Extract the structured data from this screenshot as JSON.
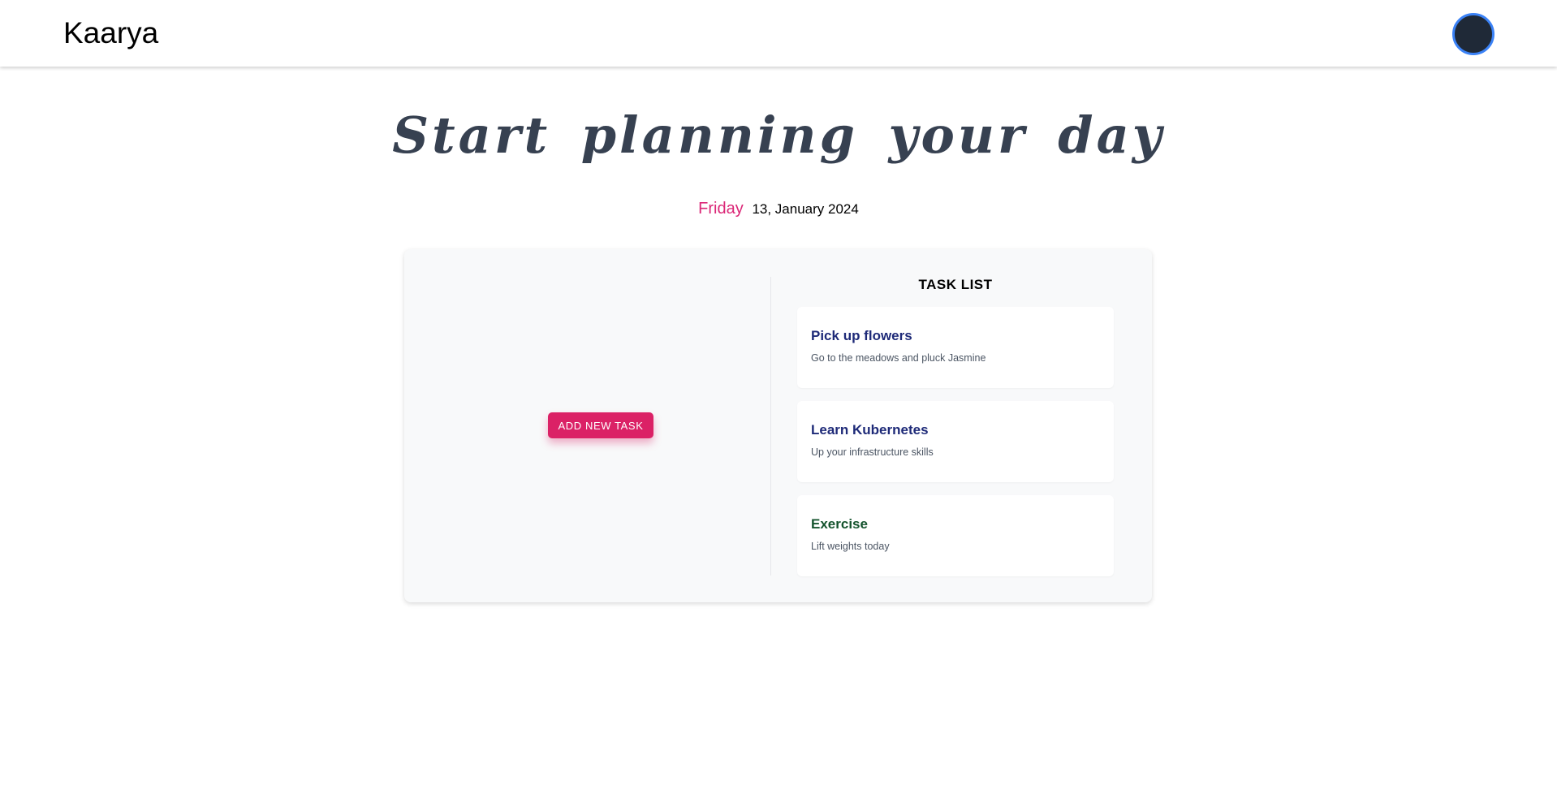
{
  "app": {
    "brand": "Kaarya"
  },
  "hero": {
    "title": "Start planning your day"
  },
  "date": {
    "weekday": "Friday",
    "rest": "13, January 2024"
  },
  "actions": {
    "add_task_label": "ADD NEW TASK"
  },
  "task_list": {
    "heading": "TASK LIST",
    "tasks": [
      {
        "title": "Pick up flowers",
        "description": "Go to the meadows and pluck Jasmine",
        "color": "#1e2a78"
      },
      {
        "title": "Learn Kubernetes",
        "description": "Up your infrastructure skills",
        "color": "#1e2a78"
      },
      {
        "title": "Exercise",
        "description": "Lift weights today",
        "color": "#14532d"
      }
    ]
  },
  "colors": {
    "accent": "#db2777",
    "button": "#db2166",
    "avatar_fill": "#1f2937",
    "avatar_ring": "#3b82f6"
  }
}
